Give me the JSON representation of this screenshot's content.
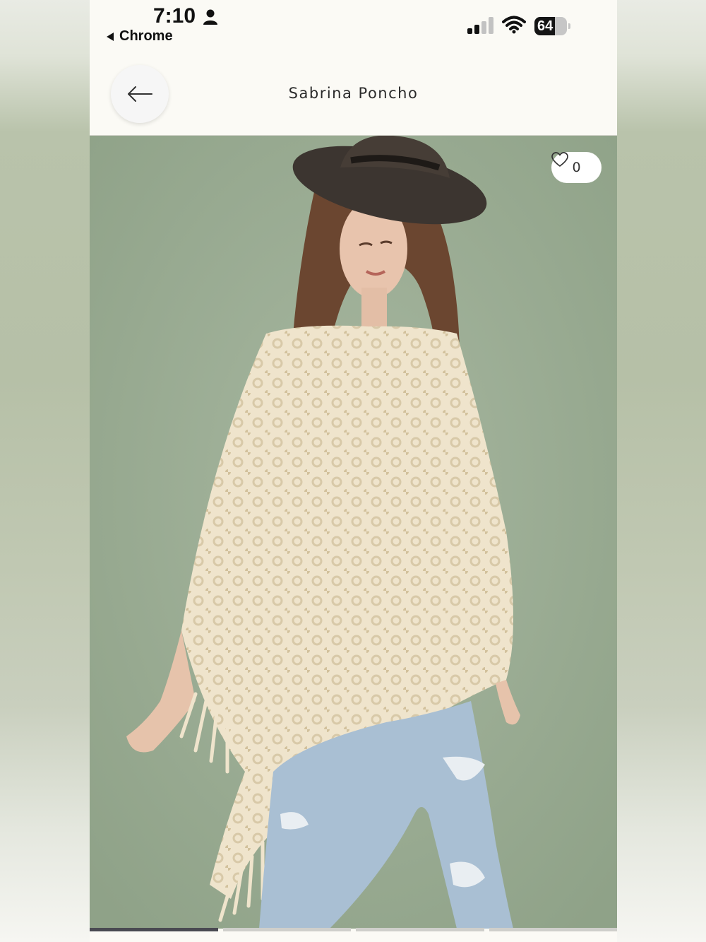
{
  "status_bar": {
    "time": "7:10",
    "back_to_app": "Chrome",
    "battery_level": "64",
    "battery_fraction": 0.64,
    "icons": [
      "person-icon",
      "signal-icon",
      "wifi-icon",
      "battery-icon"
    ]
  },
  "header": {
    "title": "Sabrina Poncho",
    "back_icon": "arrow-left-icon"
  },
  "product_image": {
    "like_count": "0",
    "like_icon": "heart-outline-icon",
    "background_color": "#9aad94"
  },
  "carousel": {
    "segments": 4,
    "active_index": 0
  },
  "colors": {
    "accent_dark": "#4a4a52",
    "header_bg": "#fbfaf5"
  }
}
